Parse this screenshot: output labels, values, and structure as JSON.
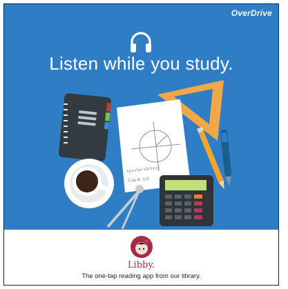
{
  "brand": {
    "name": "OverDrive"
  },
  "banner": {
    "headline": "Listen while you study."
  },
  "illustration": {
    "equation": "(a+√(a²+b²)+c) ",
    "formula": "Cos θ: 1/2"
  },
  "footer": {
    "app_name": "Libby.",
    "tagline": "The one-tap reading app from our library."
  },
  "colors": {
    "banner_bg": "#2f7dc4",
    "libby_accent": "#a42c46",
    "text_dark": "#231f20"
  },
  "icons": [
    "headphones-icon",
    "libby-logo-icon"
  ]
}
